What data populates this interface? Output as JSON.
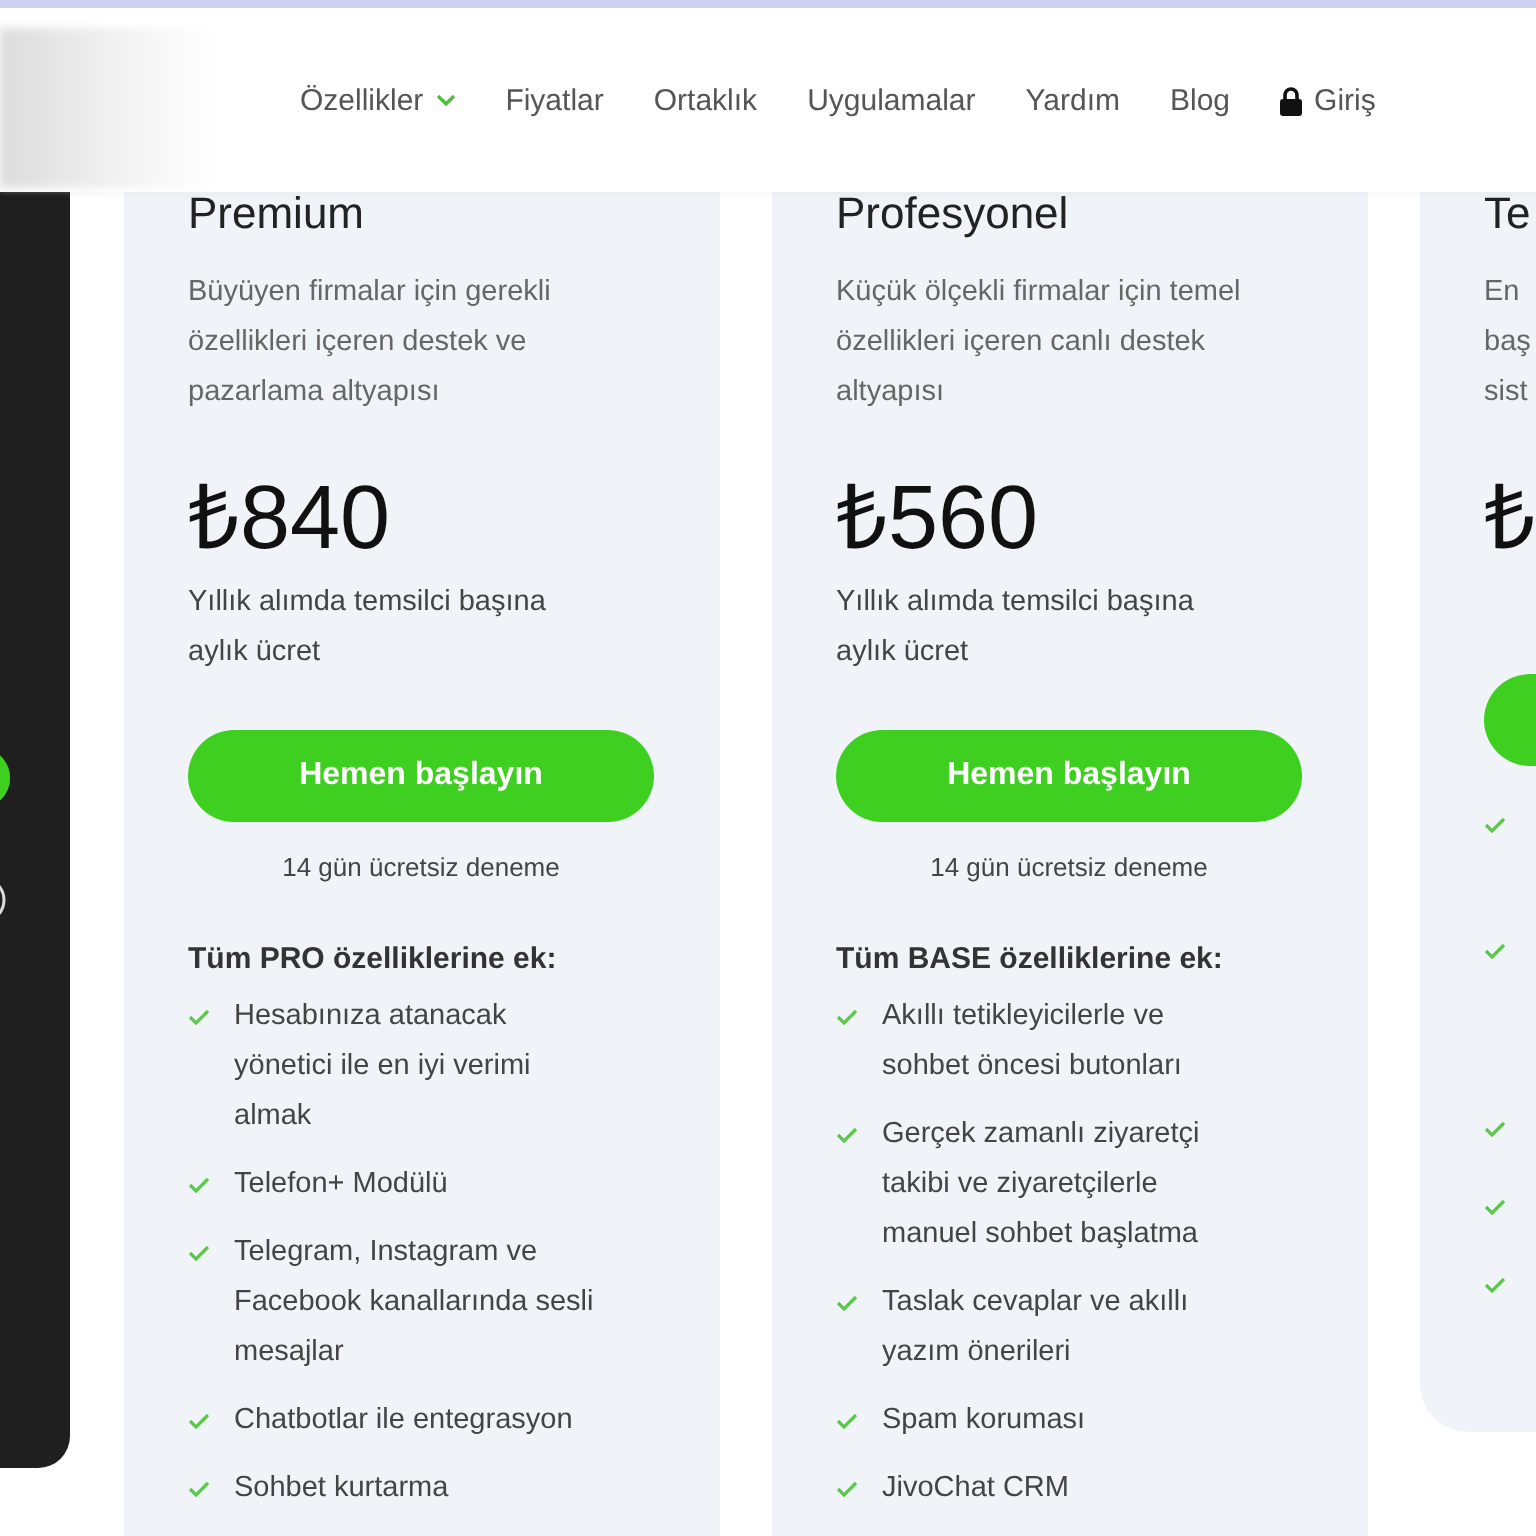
{
  "nav": {
    "items": [
      {
        "label": "Özellikler",
        "kind": "dropdown"
      },
      {
        "label": "Fiyatlar",
        "kind": "link"
      },
      {
        "label": "Ortaklık",
        "kind": "link"
      },
      {
        "label": "Uygulamalar",
        "kind": "link"
      },
      {
        "label": "Yardım",
        "kind": "link"
      },
      {
        "label": "Blog",
        "kind": "link"
      },
      {
        "label": "Giriş",
        "kind": "login"
      }
    ]
  },
  "plans": [
    {
      "title": "Premium",
      "description": "Büyüyen firmalar için gerekli özellikleri içeren destek ve pazarlama altyapısı",
      "price": "₺840",
      "price_note": "Yıllık alımda temsilci başına aylık ücret",
      "button": "Hemen başlayın",
      "trial": "14 gün ücretsiz deneme",
      "features_heading": "Tüm PRO özelliklerine ek:",
      "features": [
        "Hesabınıza atanacak yönetici ile en iyi verimi almak",
        "Telefon+ Modülü",
        "Telegram, Instagram ve Facebook kanallarında sesli mesajlar",
        "Chatbotlar ile entegrasyon",
        "Sohbet kurtarma"
      ]
    },
    {
      "title": "Profesyonel",
      "description": "Küçük ölçekli firmalar için temel özellikleri içeren canlı destek altyapısı",
      "price": "₺560",
      "price_note": "Yıllık alımda temsilci başına aylık ücret",
      "button": "Hemen başlayın",
      "trial": "14 gün ücretsiz deneme",
      "features_heading": "Tüm BASE özelliklerine ek:",
      "features": [
        "Akıllı tetikleyicilerle ve sohbet öncesi butonları",
        "Gerçek zamanlı ziyaretçi takibi ve ziyaretçilerle manuel sohbet başlatma",
        "Taslak cevaplar ve akıllı yazım önerileri",
        "Spam koruması",
        "JivoChat CRM"
      ]
    },
    {
      "title": "Te",
      "description": [
        "En",
        "baş",
        "sist"
      ],
      "price": "₺",
      "features": [
        {
          "kind": "check"
        },
        {
          "kind": "check"
        },
        {
          "kind": "check"
        },
        {
          "kind": "check"
        },
        {
          "kind": "check"
        }
      ]
    }
  ]
}
